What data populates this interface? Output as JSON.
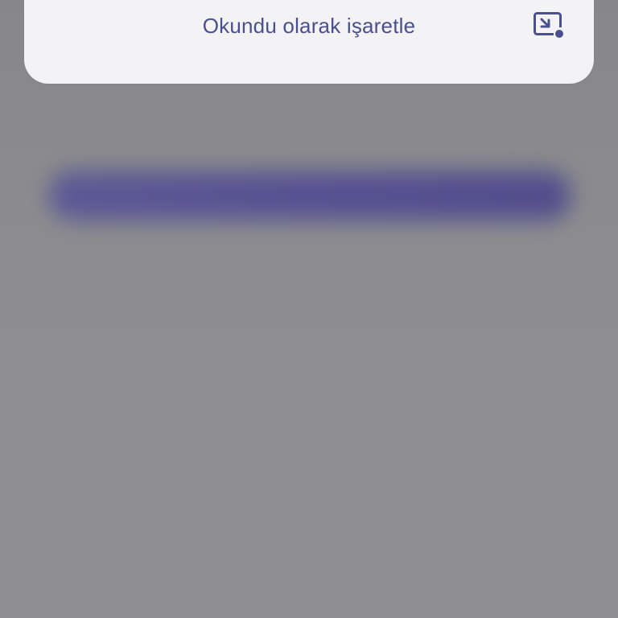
{
  "menu": {
    "mark_as_read_label": "Okundu olarak işaretle",
    "mark_as_read_icon": "mark-read-icon"
  },
  "colors": {
    "sheet_background": "#f3f3f5",
    "accent": "#4a4f8f",
    "scrim": "#8e8e91",
    "blurred_button": "#544f92"
  }
}
